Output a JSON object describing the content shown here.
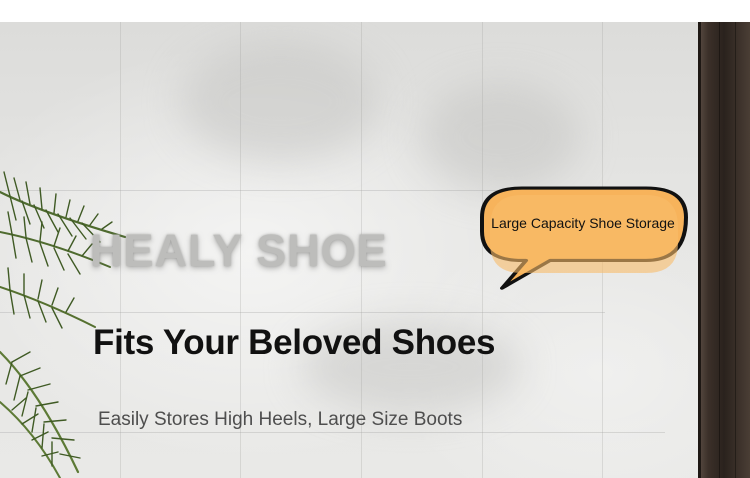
{
  "banner": {
    "brand_watermark": "HEALY SHOE",
    "callout": "Large Capacity Shoe Storage",
    "headline": "Fits Your Beloved Shoes",
    "subheadline": "Easily Stores High Heels, Large Size Boots"
  },
  "colors": {
    "callout_fill": "#f7b35b",
    "callout_outline": "#111111",
    "headline_text": "#111111",
    "subheadline_text": "#4e4e4e",
    "wall_tile": "#e6e6e4",
    "door_frame": "#2a221d"
  },
  "icons": {
    "plant": "palm-leaf-plant",
    "callout": "speech-bubble"
  }
}
